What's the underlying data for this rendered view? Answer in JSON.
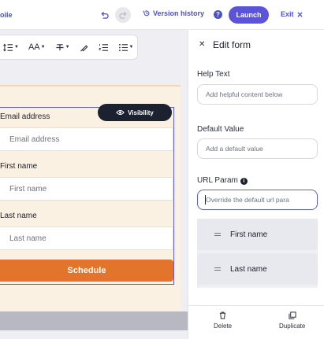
{
  "topbar": {
    "left_text": "oile",
    "history_label": "Version history",
    "help_label": "?",
    "launch_label": "Launch",
    "exit_label": "Exit"
  },
  "toolbar": {
    "items": [
      "line-height-icon",
      "font-size-icon",
      "text-style-icon",
      "paint-icon",
      "numbered-list-icon",
      "bullet-list-icon"
    ],
    "font_size_label": "AA"
  },
  "form": {
    "visibility_label": "Visibility",
    "fields": [
      {
        "label": "Email address",
        "placeholder": "Email address"
      },
      {
        "label": "First name",
        "placeholder": "First name"
      },
      {
        "label": "Last name",
        "placeholder": "Last name"
      }
    ],
    "submit_label": "Schedule",
    "accent": "#e3742c",
    "background": "#fbf1e3"
  },
  "panel": {
    "title": "Edit form",
    "help_text_label": "Help Text",
    "help_text_placeholder": "Add helpful content below",
    "default_value_label": "Default Value",
    "default_value_placeholder": "Add a default value",
    "url_param_label": "URL Param",
    "url_param_placeholder": "Override the default url para",
    "field_items": [
      "First name",
      "Last name"
    ],
    "delete_label": "Delete",
    "duplicate_label": "Duplicate"
  },
  "colors": {
    "brand": "#5b54d9",
    "selection": "#5a5fd8"
  }
}
